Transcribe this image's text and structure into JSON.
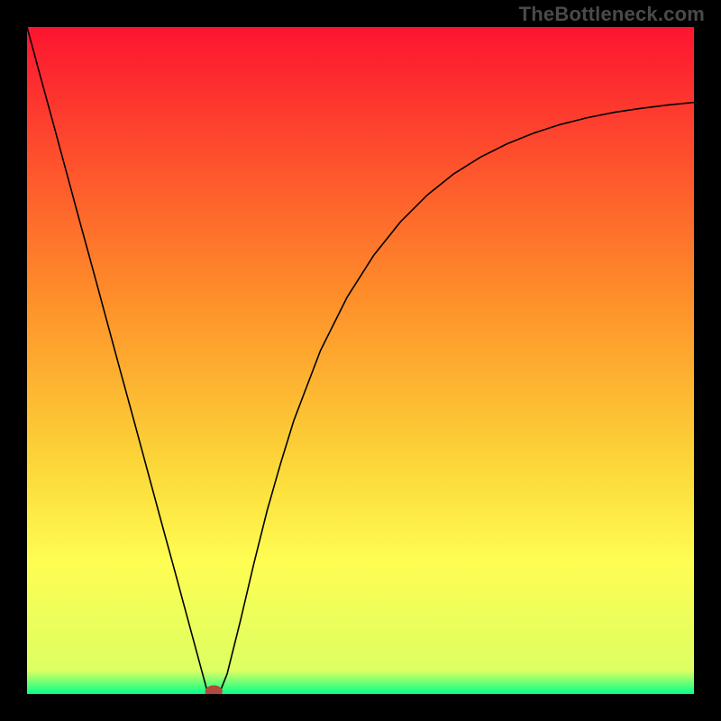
{
  "watermark": "TheBottleneck.com",
  "colors": {
    "page_bg": "#000000",
    "curve": "#000000",
    "marker_fill": "#b04a3c",
    "gradient_top": "#fd1430",
    "gradient_mid1": "#fe8d2a",
    "gradient_mid2": "#fcd838",
    "gradient_mid3": "#fffd52",
    "gradient_bottom": "#05ff89"
  },
  "chart_data": {
    "type": "line",
    "title": "",
    "xlabel": "",
    "ylabel": "",
    "xlim": [
      0,
      100
    ],
    "ylim": [
      0,
      100
    ],
    "gradient_stops": [
      {
        "offset": 0,
        "color": "#fd1430"
      },
      {
        "offset": 0.4,
        "color": "#fe8d2a"
      },
      {
        "offset": 0.66,
        "color": "#fcd838"
      },
      {
        "offset": 0.8,
        "color": "#fffd52"
      },
      {
        "offset": 0.965,
        "color": "#dcff62"
      },
      {
        "offset": 1.0,
        "color": "#05ff89"
      }
    ],
    "series": [
      {
        "name": "bottleneck-curve",
        "x": [
          0,
          2,
          4,
          6,
          8,
          10,
          12,
          14,
          16,
          18,
          20,
          22,
          24,
          26,
          27,
          28,
          29,
          30,
          32,
          34,
          36,
          38,
          40,
          44,
          48,
          52,
          56,
          60,
          64,
          68,
          72,
          76,
          80,
          84,
          88,
          92,
          96,
          100
        ],
        "y": [
          100,
          92.6,
          85.3,
          77.9,
          70.5,
          63.2,
          55.8,
          48.4,
          41.1,
          33.7,
          26.3,
          19.0,
          11.6,
          4.2,
          0.5,
          0.0,
          0.5,
          3.0,
          11.0,
          19.5,
          27.5,
          34.5,
          41.0,
          51.5,
          59.5,
          65.8,
          70.8,
          74.8,
          78.0,
          80.5,
          82.5,
          84.1,
          85.4,
          86.4,
          87.2,
          87.8,
          88.3,
          88.7
        ]
      }
    ],
    "marker": {
      "x": 28,
      "y": 0,
      "rx": 1.3,
      "ry": 0.9
    }
  }
}
